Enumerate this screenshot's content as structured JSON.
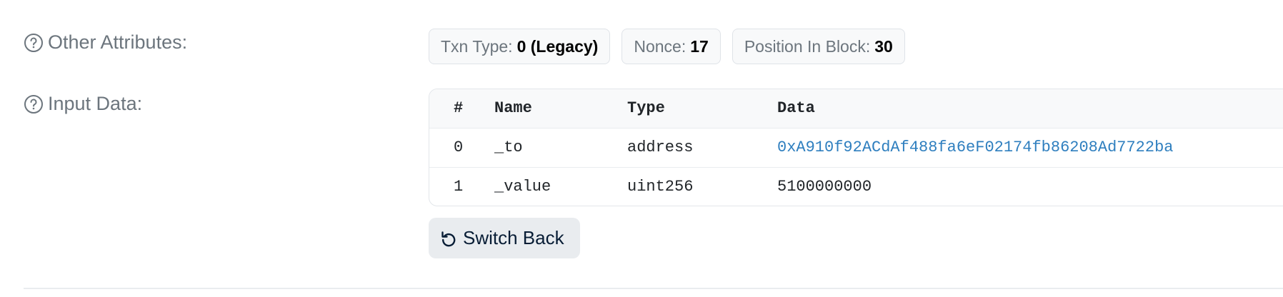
{
  "other_attributes": {
    "label": "Other Attributes:",
    "badges": [
      {
        "key": "Txn Type:",
        "value": "0 (Legacy)"
      },
      {
        "key": "Nonce:",
        "value": "17"
      },
      {
        "key": "Position In Block:",
        "value": "30"
      }
    ]
  },
  "input_data": {
    "label": "Input Data:",
    "columns": [
      "#",
      "Name",
      "Type",
      "Data"
    ],
    "rows": [
      {
        "index": "0",
        "name": "_to",
        "type": "address",
        "data": "0xA910f92ACdAf488fa6eF02174fb86208Ad7722ba",
        "is_link": true
      },
      {
        "index": "1",
        "name": "_value",
        "type": "uint256",
        "data": "5100000000",
        "is_link": false
      }
    ],
    "switch_back_label": "Switch Back"
  },
  "icons": {
    "help": "question-circle-icon",
    "switch": "undo-icon"
  },
  "colors": {
    "label_gray": "#6c757d",
    "link_blue": "#2f7fbf",
    "button_bg": "#e9ecef"
  }
}
